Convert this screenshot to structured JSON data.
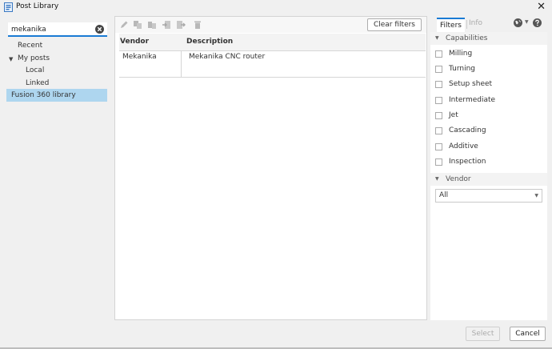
{
  "window": {
    "title": "Post Library"
  },
  "search": {
    "value": "mekanika",
    "placeholder": ""
  },
  "tree": {
    "recent": "Recent",
    "my_posts": "My posts",
    "local": "Local",
    "linked": "Linked",
    "fusion_library": "Fusion 360 library"
  },
  "toolbar": {
    "clear_filters": "Clear filters"
  },
  "table": {
    "columns": [
      "Vendor",
      "Description"
    ],
    "rows": [
      {
        "vendor": "Mekanika",
        "description": "Mekanika CNC router"
      }
    ]
  },
  "tabs": {
    "filters": "Filters",
    "info": "Info"
  },
  "filters": {
    "capabilities_heading": "Capabilities",
    "capabilities": [
      "Milling",
      "Turning",
      "Setup sheet",
      "Intermediate",
      "Jet",
      "Cascading",
      "Additive",
      "Inspection"
    ],
    "vendor_heading": "Vendor",
    "vendor_selected": "All"
  },
  "footer": {
    "select": "Select",
    "cancel": "Cancel"
  },
  "colors": {
    "accent": "#1a7bd4",
    "selection": "#aed6ef"
  }
}
